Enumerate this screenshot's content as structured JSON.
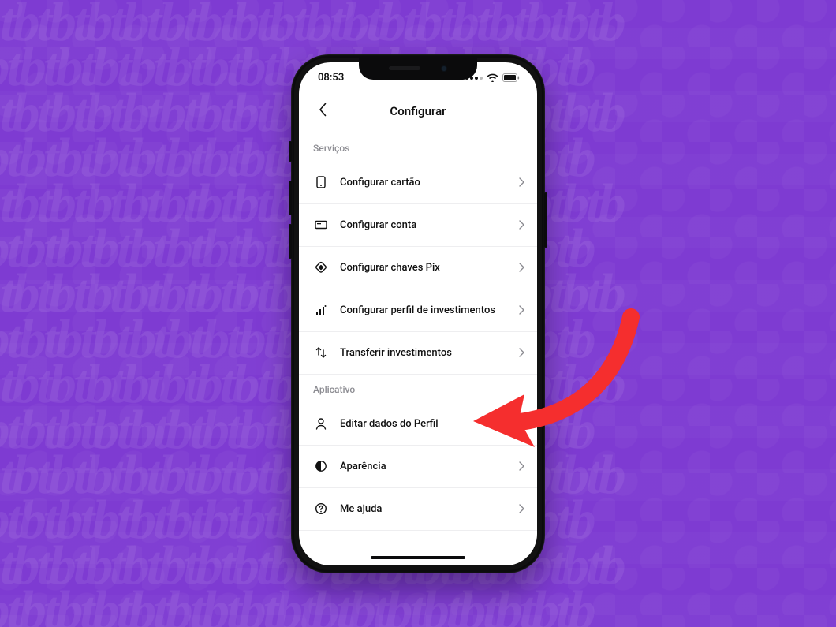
{
  "status": {
    "time": "08:53"
  },
  "header": {
    "title": "Configurar"
  },
  "sections": [
    {
      "title": "Serviços",
      "items": [
        {
          "label": "Configurar cartão"
        },
        {
          "label": "Configurar conta"
        },
        {
          "label": "Configurar chaves Pix"
        },
        {
          "label": "Configurar perfil de investimentos"
        },
        {
          "label": "Transferir investimentos"
        }
      ]
    },
    {
      "title": "Aplicativo",
      "items": [
        {
          "label": "Editar dados do Perfil"
        },
        {
          "label": "Aparência"
        },
        {
          "label": "Me ajuda"
        }
      ]
    }
  ],
  "colors": {
    "background": "#7E3BD2",
    "callout": "#F52E2E"
  }
}
